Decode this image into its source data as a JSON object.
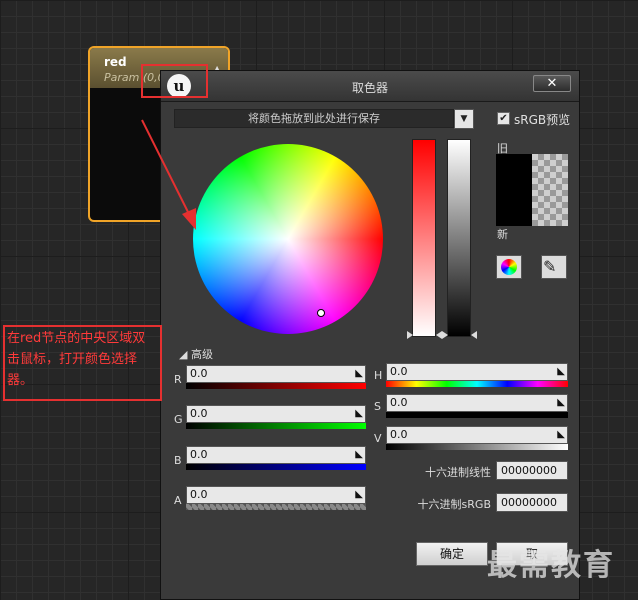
{
  "node": {
    "title": "red",
    "param": "Param (0,0"
  },
  "dialog": {
    "title": "取色器",
    "close_symbol": "✕",
    "logo_text": "u",
    "drop_area": "将颜色拖放到此处进行保存",
    "srgb_label": "sRGB预览",
    "srgb_checked": true,
    "old_label": "旧",
    "new_label": "新",
    "advanced_label": "高级",
    "rgb": [
      {
        "label": "R",
        "value": "0.0",
        "color": "#ff0000"
      },
      {
        "label": "G",
        "value": "0.0",
        "color": "#00ff00"
      },
      {
        "label": "B",
        "value": "0.0",
        "color": "#0000ff"
      },
      {
        "label": "A",
        "value": "0.0",
        "color": "#ffffff"
      }
    ],
    "hsv": [
      {
        "label": "H",
        "value": "0.0"
      },
      {
        "label": "S",
        "value": "0.0"
      },
      {
        "label": "V",
        "value": "0.0"
      }
    ],
    "hex_linear_label": "十六进制线性",
    "hex_linear_value": "00000000",
    "hex_srgb_label": "十六进制sRGB",
    "hex_srgb_value": "00000000",
    "ok_label": "确定",
    "cancel_label": "取"
  },
  "annotation": {
    "callout_text": "在red节点的中央区域双击鼠标，打开颜色选择器。"
  },
  "watermark": "最需教育"
}
